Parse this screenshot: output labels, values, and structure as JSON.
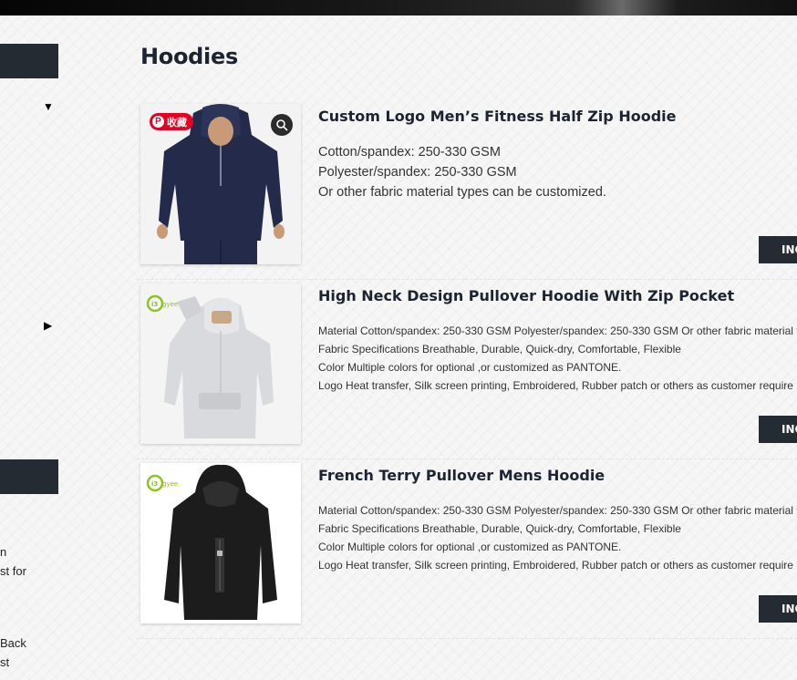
{
  "page": {
    "title": "Hoodies"
  },
  "sidebar": {
    "fragments": [
      "n",
      "st for",
      "Back",
      "st"
    ]
  },
  "pin_badge": {
    "icon": "pinterest-icon",
    "label": "收藏"
  },
  "products": [
    {
      "title": "Custom Logo Men’s Fitness Half Zip Hoodie",
      "specs": [
        "Cotton/spandex: 250-330 GSM",
        "Polyester/spandex: 250-330 GSM",
        "Or other fabric material types can be customized."
      ],
      "button_label": "INQ"
    },
    {
      "title": "High Neck Design Pullover Hoodie With Zip Pocket",
      "specs": [
        "Material Cotton/spandex: 250-330 GSM Polyester/spandex: 250-330 GSM Or other fabric material t",
        "Fabric Specifications Breathable, Durable, Quick-dry, Comfortable, Flexible",
        "Color Multiple colors for optional ,or customized as PANTONE.",
        "Logo Heat transfer, Silk screen printing, Embroidered, Rubber patch or others as customer require"
      ],
      "button_label": "INQ"
    },
    {
      "title": "French Terry Pullover Mens Hoodie",
      "specs": [
        "Material Cotton/spandex: 250-330 GSM Polyester/spandex: 250-330 GSM Or other fabric material t",
        "Fabric Specifications Breathable, Durable, Quick-dry, Comfortable, Flexible",
        "Color Multiple colors for optional ,or customized as PANTONE.",
        "Logo Heat transfer, Silk screen printing, Embroidered, Rubber patch or others as customer require"
      ],
      "button_label": "INQ"
    }
  ],
  "colors": {
    "dark_navy": "#252b33",
    "title_text": "#1b2430",
    "pinterest_red": "#e60023",
    "brand_green": "#8dc21f"
  }
}
